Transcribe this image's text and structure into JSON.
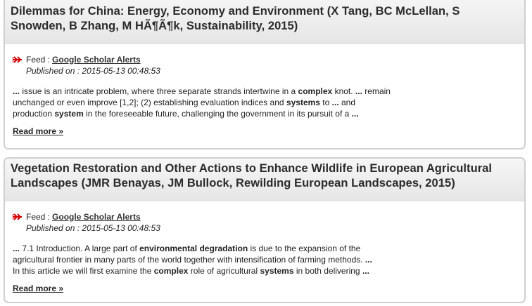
{
  "articles": [
    {
      "title": "Dilemmas for China: Energy, Economy and Environment (X Tang, BC McLellan, S Snowden, B Zhang, M HÃ¶Ã¶k, Sustainability, 2015)",
      "feed_prefix": "Feed :",
      "feed_name": "Google Scholar Alerts",
      "published": "Published on : 2015-05-13 00:48:53",
      "excerpt_lines": [
        [
          {
            "t": "...",
            "b": true
          },
          {
            "t": " issue is an intricate problem, where three separate strands intertwine in a ",
            "b": false
          },
          {
            "t": "complex",
            "b": true
          },
          {
            "t": " knot. ",
            "b": false
          },
          {
            "t": "...",
            "b": true
          },
          {
            "t": " remain",
            "b": false
          }
        ],
        [
          {
            "t": "unchanged or even improve [1,2]; (2) establishing evaluation indices and ",
            "b": false
          },
          {
            "t": "systems",
            "b": true
          },
          {
            "t": " to ",
            "b": false
          },
          {
            "t": "...",
            "b": true
          },
          {
            "t": " and",
            "b": false
          }
        ],
        [
          {
            "t": "production ",
            "b": false
          },
          {
            "t": "system",
            "b": true
          },
          {
            "t": " in the foreseeable future, challenging the government in its pursuit of a ",
            "b": false
          },
          {
            "t": "...",
            "b": true
          }
        ]
      ],
      "read_more": "Read more »"
    },
    {
      "title": "Vegetation Restoration and Other Actions to Enhance Wildlife in European Agricultural Landscapes (JMR Benayas, JM Bullock, Rewilding European Landscapes, 2015)",
      "feed_prefix": "Feed :",
      "feed_name": "Google Scholar Alerts",
      "published": "Published on : 2015-05-13 00:48:53",
      "excerpt_lines": [
        [
          {
            "t": "...",
            "b": true
          },
          {
            "t": " 7.1 Introduction. A large part of ",
            "b": false
          },
          {
            "t": "environmental degradation",
            "b": true
          },
          {
            "t": " is due to the expansion of the",
            "b": false
          }
        ],
        [
          {
            "t": "agricultural frontier in many parts of the world together with intensification of farming methods. ",
            "b": false
          },
          {
            "t": "...",
            "b": true
          }
        ],
        [
          {
            "t": "In this article we will first examine the ",
            "b": false
          },
          {
            "t": "complex",
            "b": true
          },
          {
            "t": " role of agricultural ",
            "b": false
          },
          {
            "t": "systems",
            "b": true
          },
          {
            "t": " in both delivering ",
            "b": false
          },
          {
            "t": "...",
            "b": true
          }
        ]
      ],
      "read_more": "Read more »"
    }
  ],
  "colors": {
    "feed_icon": "#d40000",
    "title_text": "#2b2b2b",
    "card_border": "#cfcfcf"
  },
  "icons": {
    "feed": "feed-arrow-icon"
  }
}
